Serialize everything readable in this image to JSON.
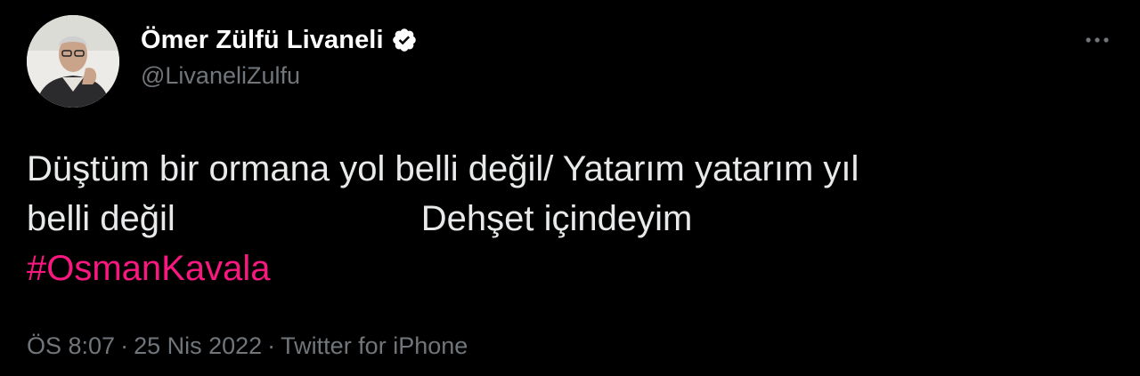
{
  "author": {
    "display_name": "Ömer Zülfü Livaneli",
    "handle": "@LivaneliZulfu",
    "verified": true,
    "avatar_icon": "profile-photo"
  },
  "menu": {
    "icon": "more-horizontal-icon"
  },
  "tweet": {
    "line1": "Düştüm bir ormana yol belli değil/ Yatarım yatarım yıl",
    "line2a": "belli değil",
    "line2b": "Dehşet içindeyim",
    "hashtag": "#OsmanKavala"
  },
  "meta": {
    "time": "ÖS 8:07",
    "separator": "·",
    "date": "25 Nis 2022",
    "source": "Twitter for iPhone"
  },
  "colors": {
    "background": "#000000",
    "text": "#e7e9ea",
    "secondary": "#71767b",
    "hashtag": "#f91880",
    "verified_badge": "#ffffff"
  }
}
